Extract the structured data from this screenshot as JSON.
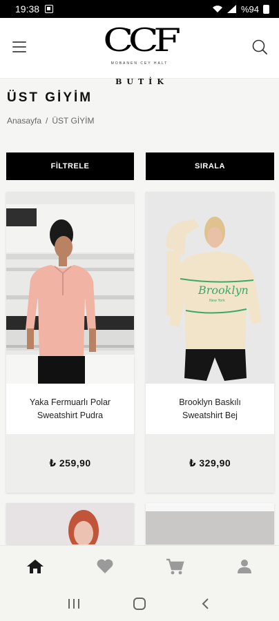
{
  "status_bar": {
    "time": "19:38",
    "battery": "%94"
  },
  "header": {
    "logo_mark": "CCF",
    "logo_subtitle": "MOBANEN CEY HALT",
    "logo_name": "BUTİK"
  },
  "page": {
    "title": "ÜST GİYİM",
    "breadcrumb": [
      "Anasayfa",
      "/",
      "ÜST GİYİM"
    ]
  },
  "actions": {
    "filter_label": "FİLTRELE",
    "sort_label": "SIRALA"
  },
  "products": [
    {
      "name": "Yaka Fermuarlı Polar Sweatshirt Pudra",
      "price": "₺ 259,90"
    },
    {
      "name": "Brooklyn Baskılı Sweatshirt Bej",
      "price": "₺ 329,90"
    }
  ],
  "bottom_nav": {
    "items": [
      "home-icon",
      "heart-icon",
      "cart-icon",
      "user-icon"
    ],
    "active": "home-icon"
  },
  "colors": {
    "accent": "#000000",
    "nav_icon": "#9a9a9a",
    "nav_active": "#1a1a1a",
    "print_green": "#3aa86b"
  }
}
